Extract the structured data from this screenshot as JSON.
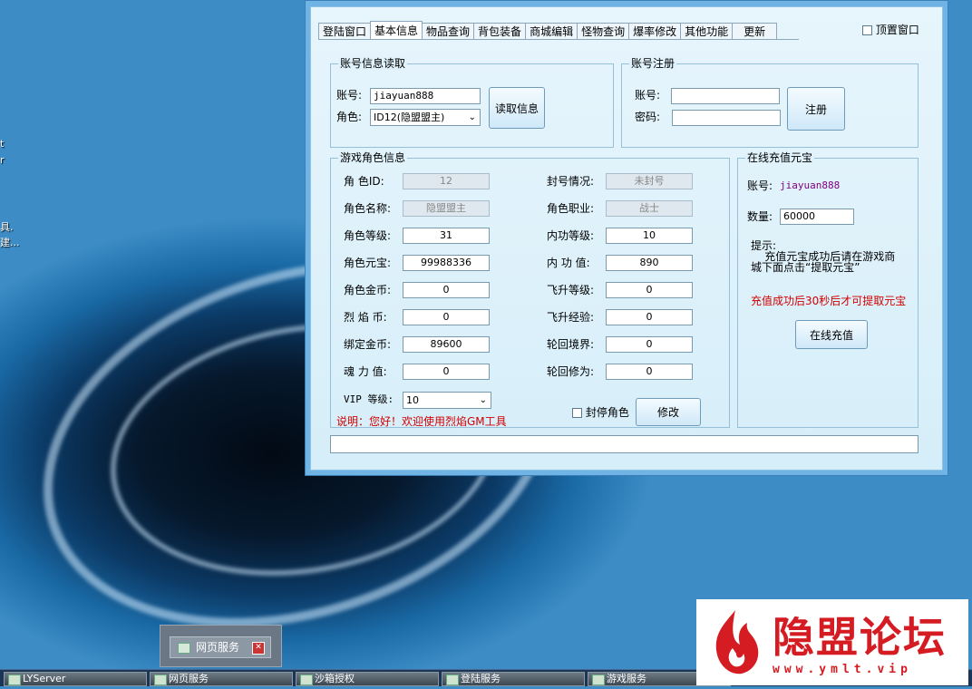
{
  "desktop": {
    "edge_texts": [
      "t",
      "r",
      "具.",
      "建..."
    ]
  },
  "window": {
    "tabs": [
      {
        "label": "登陆窗口",
        "active": false
      },
      {
        "label": "基本信息",
        "active": true
      },
      {
        "label": "物品查询",
        "active": false
      },
      {
        "label": "背包装备",
        "active": false
      },
      {
        "label": "商城编辑",
        "active": false
      },
      {
        "label": "怪物查询",
        "active": false
      },
      {
        "label": "爆率修改",
        "active": false
      },
      {
        "label": "其他功能",
        "active": false
      },
      {
        "label": "更新",
        "active": false
      }
    ],
    "topmost_label": "顶置窗口",
    "account_read": {
      "title": "账号信息读取",
      "account_label": "账号:",
      "account_value": "jiayuan888",
      "role_label": "角色:",
      "role_value": "ID12(隐盟盟主)",
      "read_button": "读取信息"
    },
    "register": {
      "title": "账号注册",
      "account_label": "账号:",
      "account_value": "",
      "password_label": "密码:",
      "password_value": "",
      "register_button": "注册"
    },
    "role_info": {
      "title": "游戏角色信息",
      "left": [
        {
          "label": "角  色ID:",
          "value": "12",
          "readonly": true
        },
        {
          "label": "角色名称:",
          "value": "隐盟盟主",
          "readonly": true
        },
        {
          "label": "角色等级:",
          "value": "31",
          "readonly": false
        },
        {
          "label": "角色元宝:",
          "value": "99988336",
          "readonly": false
        },
        {
          "label": "角色金币:",
          "value": "0",
          "readonly": false
        },
        {
          "label": "烈 焰 币:",
          "value": "0",
          "readonly": false
        },
        {
          "label": "绑定金币:",
          "value": "89600",
          "readonly": false
        },
        {
          "label": "魂 力 值:",
          "value": "0",
          "readonly": false
        }
      ],
      "right": [
        {
          "label": "封号情况:",
          "value": "未封号",
          "readonly": true
        },
        {
          "label": "角色职业:",
          "value": "战士",
          "readonly": true
        },
        {
          "label": "内功等级:",
          "value": "10",
          "readonly": false
        },
        {
          "label": "内 功 值:",
          "value": "890",
          "readonly": false
        },
        {
          "label": "飞升等级:",
          "value": "0",
          "readonly": false
        },
        {
          "label": "飞升经验:",
          "value": "0",
          "readonly": false
        },
        {
          "label": "轮回境界:",
          "value": "0",
          "readonly": false
        },
        {
          "label": "轮回修为:",
          "value": "0",
          "readonly": false
        }
      ],
      "vip_label": "VIP 等级:",
      "vip_value": "10",
      "ban_label": "封停角色",
      "modify_button": "修改",
      "note": "说明：您好！欢迎使用烈焰GM工具"
    },
    "recharge": {
      "title": "在线充值元宝",
      "account_label": "账号:",
      "account_value": "jiayuan888",
      "amount_label": "数量:",
      "amount_value": "60000",
      "tip_title": "提示:",
      "tip_line1": "    充值元宝成功后请在游戏商",
      "tip_line2": "城下面点击“提取元宝”",
      "warning": "充值成功后30秒后才可提取元宝",
      "recharge_button": "在线充值"
    },
    "status_bar": ""
  },
  "popup": {
    "label": "网页服务",
    "close": "✕"
  },
  "taskbar": {
    "items": [
      "LYServer",
      "网页服务",
      "沙箱授权",
      "登陆服务",
      "游戏服务"
    ]
  },
  "watermark": {
    "title": "隐盟论坛",
    "url": "www.ymlt.vip"
  },
  "colors": {
    "accent_red": "#d10000",
    "recharge_account": "#800080",
    "watermark_red": "#d41c22"
  }
}
